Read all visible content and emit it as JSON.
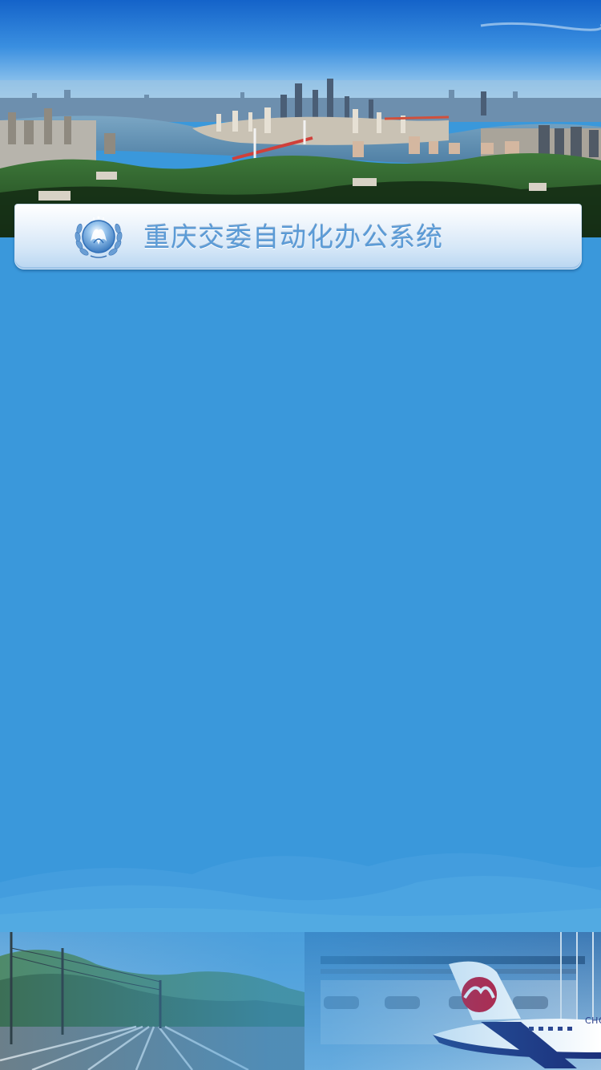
{
  "app": {
    "title": "重庆交委自动化办公系统"
  },
  "banner": {
    "logo_icon": "laurel-emblem-icon"
  },
  "footer": {
    "aircraft_livery_text": "CHO"
  },
  "colors": {
    "background": "#3a98db",
    "banner_text": "#5b9bd6",
    "sky_top": "#1f6fd0",
    "sky_bottom": "#8ec3ea"
  }
}
